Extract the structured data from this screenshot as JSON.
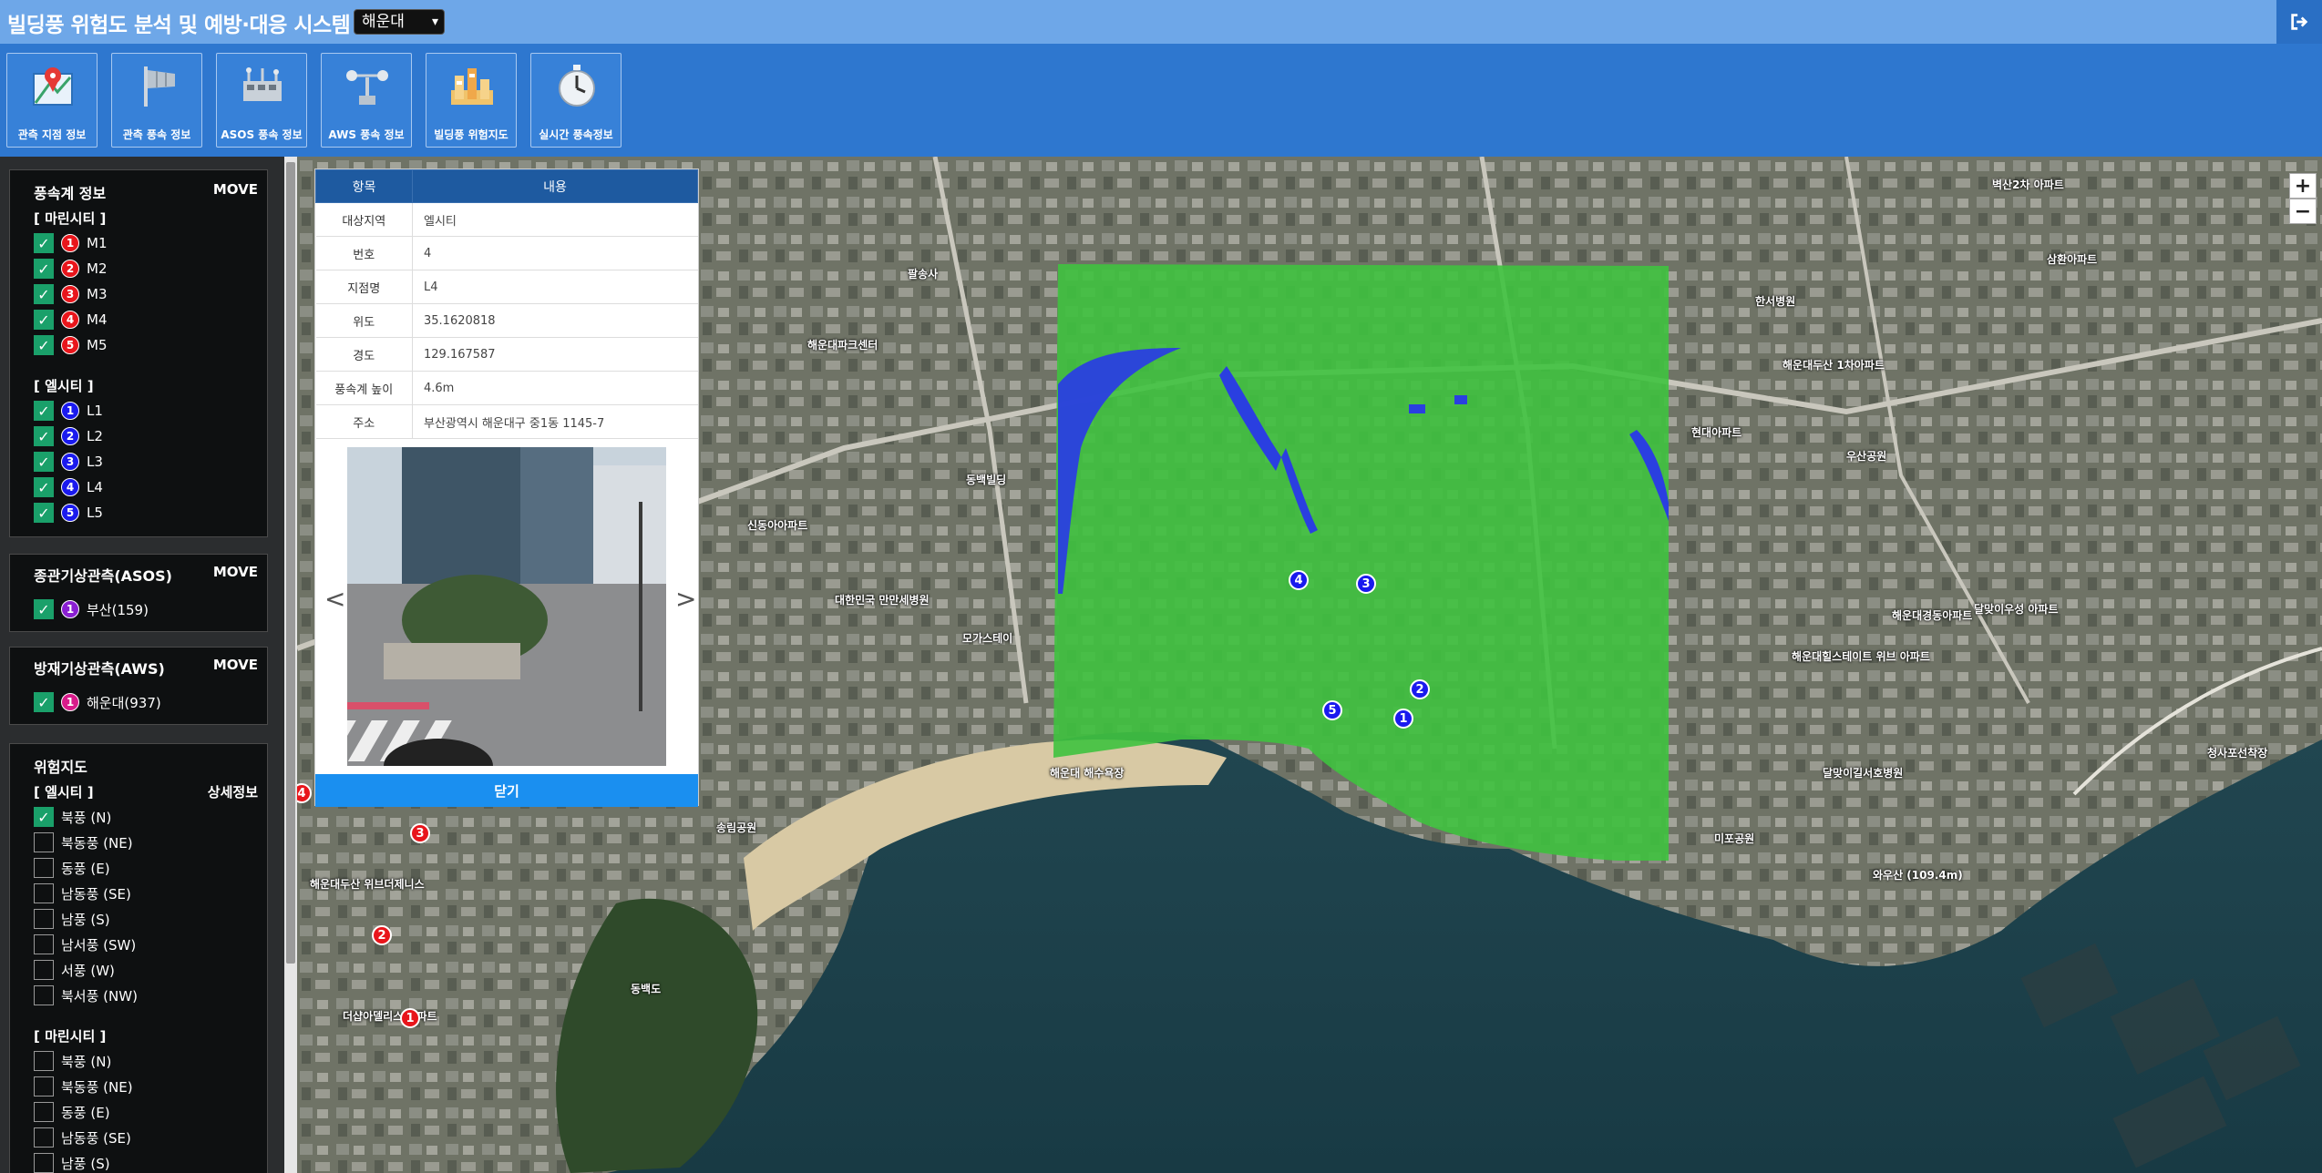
{
  "header": {
    "title": "빌딩풍 위험도 분석 및 예방·대응 시스템",
    "region": "해운대"
  },
  "toolbar": [
    {
      "label": "관측 지점 정보",
      "icon": "map-pin-icon"
    },
    {
      "label": "관측 풍속 정보",
      "icon": "windsock-icon"
    },
    {
      "label": "ASOS 풍속 정보",
      "icon": "weather-station-icon"
    },
    {
      "label": "AWS 풍속 정보",
      "icon": "anemometer-icon"
    },
    {
      "label": "빌딩풍 위험지도",
      "icon": "city-map-icon"
    },
    {
      "label": "실시간 풍속정보",
      "icon": "stopwatch-icon"
    }
  ],
  "wind_panel": {
    "title": "풍속계 정보",
    "move": "MOVE",
    "groups": [
      {
        "name": "[ 마린시티 ]",
        "color": "#e8151b",
        "items": [
          {
            "num": "1",
            "label": "M1"
          },
          {
            "num": "2",
            "label": "M2"
          },
          {
            "num": "3",
            "label": "M3"
          },
          {
            "num": "4",
            "label": "M4"
          },
          {
            "num": "5",
            "label": "M5"
          }
        ]
      },
      {
        "name": "[ 엘시티 ]",
        "color": "#1a1aee",
        "items": [
          {
            "num": "1",
            "label": "L1"
          },
          {
            "num": "2",
            "label": "L2"
          },
          {
            "num": "3",
            "label": "L3"
          },
          {
            "num": "4",
            "label": "L4"
          },
          {
            "num": "5",
            "label": "L5"
          }
        ]
      }
    ]
  },
  "asos_panel": {
    "title": "종관기상관측(ASOS)",
    "move": "MOVE",
    "items": [
      {
        "num": "1",
        "label": "부산(159)",
        "color": "#8a1fd1"
      }
    ]
  },
  "aws_panel": {
    "title": "방재기상관측(AWS)",
    "move": "MOVE",
    "items": [
      {
        "num": "1",
        "label": "해운대(937)",
        "color": "#d81b8a"
      }
    ]
  },
  "risk_panel": {
    "title": "위험지도",
    "detail": "상세정보",
    "groups": [
      {
        "name": "[ 엘시티 ]",
        "items": [
          {
            "label": "북풍 (N)",
            "checked": true
          },
          {
            "label": "북동풍 (NE)",
            "checked": false
          },
          {
            "label": "동풍 (E)",
            "checked": false
          },
          {
            "label": "남동풍 (SE)",
            "checked": false
          },
          {
            "label": "남풍 (S)",
            "checked": false
          },
          {
            "label": "남서풍 (SW)",
            "checked": false
          },
          {
            "label": "서풍 (W)",
            "checked": false
          },
          {
            "label": "북서풍 (NW)",
            "checked": false
          }
        ]
      },
      {
        "name": "[ 마린시티 ]",
        "items": [
          {
            "label": "북풍 (N)",
            "checked": false
          },
          {
            "label": "북동풍 (NE)",
            "checked": false
          },
          {
            "label": "동풍 (E)",
            "checked": false
          },
          {
            "label": "남동풍 (SE)",
            "checked": false
          },
          {
            "label": "남풍 (S)",
            "checked": false
          }
        ]
      }
    ]
  },
  "info_popup": {
    "col_item": "항목",
    "col_content": "내용",
    "rows": [
      {
        "key": "대상지역",
        "val": "엘시티"
      },
      {
        "key": "번호",
        "val": "4"
      },
      {
        "key": "지점명",
        "val": "L4"
      },
      {
        "key": "위도",
        "val": "35.1620818"
      },
      {
        "key": "경도",
        "val": "129.167587"
      },
      {
        "key": "풍속계 높이",
        "val": "4.6m"
      },
      {
        "key": "주소",
        "val": "부산광역시 해운대구 중1동 1145-7"
      }
    ],
    "prev": "<",
    "next": ">",
    "close": "닫기"
  },
  "map": {
    "zoom_in": "+",
    "zoom_out": "−",
    "labels": [
      "해운대 해수욕장",
      "동백도",
      "송림공원",
      "더샵아델리스 아파트",
      "해운대두산 위브더제니스",
      "모가스테이",
      "대한민국 만만세병원",
      "신동아아파트",
      "동백빌딩",
      "미포공원",
      "와우산 (109.4m)",
      "청사포선착장",
      "달맞이길서호병원",
      "해운대경동아파트",
      "달맞이우성 아파트",
      "해운대힐스테이트 위브 아파트",
      "우산공원",
      "현대아파트",
      "한서병원",
      "해운대두산 1차아파트",
      "삼환아파트",
      "벽산2차 아파트",
      "해운대파크센터",
      "팔송사"
    ],
    "markers": [
      {
        "num": "4",
        "color": "#1a1aee"
      },
      {
        "num": "3",
        "color": "#1a1aee"
      },
      {
        "num": "2",
        "color": "#1a1aee"
      },
      {
        "num": "5",
        "color": "#1a1aee"
      },
      {
        "num": "1",
        "color": "#1a1aee"
      },
      {
        "num": "3",
        "color": "#e8151b"
      },
      {
        "num": "2",
        "color": "#e8151b"
      },
      {
        "num": "1",
        "color": "#e8151b"
      },
      {
        "num": "4",
        "color": "#e8151b"
      }
    ]
  },
  "colors": {
    "header_bg": "#6ea7e8",
    "toolbar_bg": "#2e77cf",
    "risk_safe": "#3fc23f",
    "risk_warn": "#2a3fe0",
    "popup_header": "#1e5aa0",
    "close_btn": "#1a8ff0"
  }
}
